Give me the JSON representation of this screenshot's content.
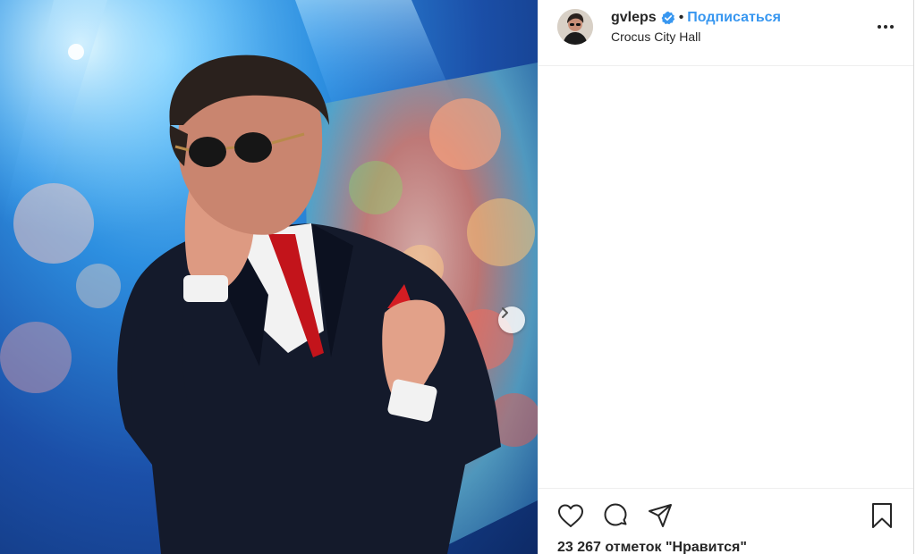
{
  "post": {
    "author": {
      "username": "gvleps",
      "verified": true,
      "separator": "•",
      "follow_label": "Подписаться",
      "location": "Crocus City Hall"
    },
    "media": {
      "carousel_next_icon": "chevron-right-icon"
    },
    "actions": {
      "icons": [
        "heart-icon",
        "comment-icon",
        "share-icon",
        "bookmark-icon"
      ],
      "more_icon": "more-options-icon"
    },
    "likes_text": "23 267 отметок \"Нравится\""
  },
  "colors": {
    "link_blue": "#3897f0",
    "verified_blue": "#3897f0",
    "text": "#262626",
    "border": "#efefef"
  }
}
